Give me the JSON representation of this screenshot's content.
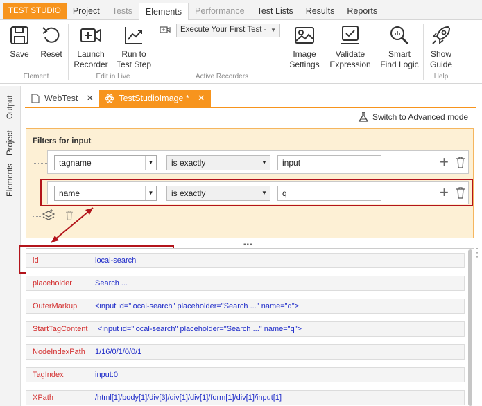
{
  "menubar": {
    "brand": "TEST STUDIO",
    "items": [
      {
        "label": "Project",
        "state": "normal"
      },
      {
        "label": "Tests",
        "state": "disabled"
      },
      {
        "label": "Elements",
        "state": "active"
      },
      {
        "label": "Performance",
        "state": "disabled"
      },
      {
        "label": "Test Lists",
        "state": "normal"
      },
      {
        "label": "Results",
        "state": "normal"
      },
      {
        "label": "Reports",
        "state": "normal"
      }
    ]
  },
  "ribbon": {
    "save": "Save",
    "reset": "Reset",
    "element_group": "Element",
    "launch_recorder_1": "Launch",
    "launch_recorder_2": "Recorder",
    "run_to_test_step_1": "Run to",
    "run_to_test_step_2": "Test Step",
    "edit_in_live_group": "Edit in Live",
    "recorder_dropdown": "Execute Your First Test -",
    "active_recorders_group": "Active Recorders",
    "image_settings_1": "Image",
    "image_settings_2": "Settings",
    "validate_expression_1": "Validate",
    "validate_expression_2": "Expression",
    "smart_find_logic_1": "Smart",
    "smart_find_logic_2": "Find Logic",
    "show_guide_1": "Show",
    "show_guide_2": "Guide",
    "help_group": "Help"
  },
  "siderail": {
    "output": "Output",
    "project": "Project",
    "elements": "Elements"
  },
  "doc_tabs": {
    "tab1": "WebTest",
    "tab2": "TestStudioImage *",
    "close": "✕"
  },
  "advanced_mode": "Switch to Advanced mode",
  "filters": {
    "title": "Filters for input",
    "rows": [
      {
        "attribute": "tagname",
        "operator": "is exactly",
        "value": "input"
      },
      {
        "attribute": "name",
        "operator": "is exactly",
        "value": "q"
      }
    ]
  },
  "properties": [
    {
      "name": "id",
      "value": "local-search"
    },
    {
      "name": "placeholder",
      "value": "Search ..."
    },
    {
      "name": "OuterMarkup",
      "value": "<input id=\"local-search\" placeholder=\"Search ...\" name=\"q\">"
    },
    {
      "name": "StartTagContent",
      "value": "<input id=\"local-search\" placeholder=\"Search ...\" name=\"q\">"
    },
    {
      "name": "NodeIndexPath",
      "value": "1/16/0/1/0/0/1"
    },
    {
      "name": "TagIndex",
      "value": "input:0"
    },
    {
      "name": "XPath",
      "value": "/html[1]/body[1]/div[3]/div[1]/div[1]/form[1]/div[1]/input[1]"
    }
  ],
  "colors": {
    "accent": "#f7941d",
    "highlight": "#b3141b",
    "prop_name": "#d32f2f",
    "prop_value": "#1f2cc9",
    "filter_bg": "#fdf0d5"
  }
}
